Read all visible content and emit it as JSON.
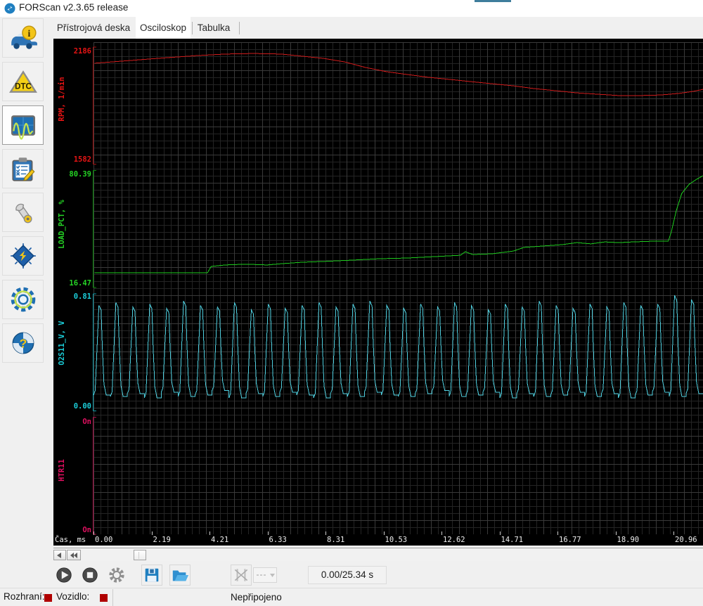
{
  "window": {
    "title": "FORScan v2.3.65 release"
  },
  "colors": {
    "accent": "#1f7fc0",
    "status_indicator": "#b00000",
    "plot_background": "#000000",
    "grid_minor": "#242424",
    "grid_major": "#3a3a3a",
    "background_window_edge": "#3f7d9c"
  },
  "sidebar": {
    "items": [
      {
        "icon": "car-info-icon",
        "selected": false
      },
      {
        "icon": "dtc-warning-triangle-icon",
        "selected": false
      },
      {
        "icon": "oscilloscope-wave-icon",
        "selected": true
      },
      {
        "icon": "clipboard-checklist-icon",
        "selected": false
      },
      {
        "icon": "wrench-icon",
        "selected": false
      },
      {
        "icon": "chip-module-icon",
        "selected": false
      },
      {
        "icon": "gear-icon",
        "selected": false
      },
      {
        "icon": "help-question-icon",
        "selected": false
      }
    ]
  },
  "tabs": [
    {
      "label": "Přístrojová deska",
      "selected": false
    },
    {
      "label": "Osciloskop",
      "selected": true
    },
    {
      "label": "Tabulka",
      "selected": false
    }
  ],
  "chart_data": {
    "type": "line",
    "title": "",
    "xlabel": "Čas, ms",
    "x_ticks": [
      "0.00",
      "2.19",
      "4.21",
      "6.33",
      "8.31",
      "10.53",
      "12.62",
      "14.71",
      "16.77",
      "18.90",
      "20.96"
    ],
    "grid": true,
    "panels": 4,
    "legend": "axis-labels-left",
    "series": [
      {
        "name": "RPM",
        "label": "RPM, 1/min",
        "unit": "1/min",
        "color": "#cf1b1b",
        "label_color": "#e51414",
        "axis_color": "#a81111",
        "axis_max": "2186",
        "axis_min": "1582",
        "ymax": 2186,
        "ymin": 1582,
        "points": [
          [
            0.002,
            2103
          ],
          [
            0.031,
            2110
          ],
          [
            0.077,
            2121
          ],
          [
            0.123,
            2132
          ],
          [
            0.17,
            2142
          ],
          [
            0.216,
            2150
          ],
          [
            0.262,
            2153
          ],
          [
            0.308,
            2150
          ],
          [
            0.343,
            2139
          ],
          [
            0.377,
            2128
          ],
          [
            0.412,
            2110
          ],
          [
            0.446,
            2081
          ],
          [
            0.481,
            2059
          ],
          [
            0.516,
            2044
          ],
          [
            0.55,
            2030
          ],
          [
            0.585,
            2019
          ],
          [
            0.619,
            2008
          ],
          [
            0.654,
            1997
          ],
          [
            0.689,
            1986
          ],
          [
            0.723,
            1972
          ],
          [
            0.758,
            1961
          ],
          [
            0.793,
            1950
          ],
          [
            0.827,
            1943
          ],
          [
            0.862,
            1936
          ],
          [
            0.896,
            1936
          ],
          [
            0.931,
            1939
          ],
          [
            0.96,
            1947
          ],
          [
            0.983,
            1957
          ],
          [
            1.0,
            1968
          ]
        ]
      },
      {
        "name": "LOAD_PCT",
        "label": "LOAD_PCT, %",
        "unit": "%",
        "color": "#1ecb1e",
        "label_color": "#25d425",
        "axis_color": "#0b8f0b",
        "axis_max": "80.39",
        "axis_min": "16.47",
        "ymax": 80.39,
        "ymin": 16.47,
        "points": [
          [
            0.002,
            24.5
          ],
          [
            0.187,
            24.5
          ],
          [
            0.193,
            28.0
          ],
          [
            0.216,
            28.8
          ],
          [
            0.25,
            29.2
          ],
          [
            0.285,
            28.8
          ],
          [
            0.308,
            29.5
          ],
          [
            0.343,
            30.3
          ],
          [
            0.377,
            30.7
          ],
          [
            0.423,
            31.4
          ],
          [
            0.47,
            32.2
          ],
          [
            0.516,
            32.6
          ],
          [
            0.562,
            33.4
          ],
          [
            0.602,
            34.1
          ],
          [
            0.61,
            36.0
          ],
          [
            0.622,
            34.5
          ],
          [
            0.654,
            34.9
          ],
          [
            0.689,
            36.4
          ],
          [
            0.706,
            38.4
          ],
          [
            0.735,
            39.1
          ],
          [
            0.769,
            39.9
          ],
          [
            0.793,
            41.0
          ],
          [
            0.816,
            40.3
          ],
          [
            0.839,
            41.4
          ],
          [
            0.862,
            41.0
          ],
          [
            0.885,
            41.4
          ],
          [
            0.92,
            41.8
          ],
          [
            0.943,
            41.8
          ],
          [
            0.948,
            46.8
          ],
          [
            0.956,
            58.3
          ],
          [
            0.965,
            67.8
          ],
          [
            0.977,
            72.8
          ],
          [
            0.989,
            75.5
          ],
          [
            1.0,
            77.5
          ]
        ]
      },
      {
        "name": "O2S11_V",
        "label": "O2S11_V, V",
        "unit": "V",
        "color": "#4fd0e0",
        "label_color": "#1bcdd8",
        "axis_color": "#0f9aa8",
        "axis_max": "0.81",
        "axis_min": "0.00",
        "ymax": 0.81,
        "ymin": 0.0,
        "waveform": {
          "cycles": 36,
          "cycle_shape": [
            [
              0.0,
              0.0
            ],
            [
              0.1,
              0.05
            ],
            [
              0.32,
              1.0
            ],
            [
              0.45,
              0.95
            ],
            [
              0.52,
              0.55
            ],
            [
              0.62,
              0.12
            ],
            [
              0.75,
              0.0
            ],
            [
              1.0,
              0.0
            ]
          ],
          "peaks": [
            0.73,
            0.75,
            0.72,
            0.74,
            0.71,
            0.76,
            0.73,
            0.72,
            0.75,
            0.7,
            0.74,
            0.71,
            0.73,
            0.75,
            0.72,
            0.74,
            0.76,
            0.73,
            0.71,
            0.74,
            0.72,
            0.75,
            0.73,
            0.7,
            0.74,
            0.72,
            0.76,
            0.73,
            0.71,
            0.74,
            0.72,
            0.75,
            0.73,
            0.74,
            0.8,
            0.77
          ],
          "troughs": [
            0.11,
            0.1,
            0.12,
            0.09,
            0.13,
            0.1,
            0.11,
            0.14,
            0.09,
            0.12,
            0.1,
            0.13,
            0.11,
            0.09,
            0.12,
            0.1,
            0.13,
            0.11,
            0.1,
            0.12,
            0.14,
            0.1,
            0.11,
            0.13,
            0.09,
            0.12,
            0.1,
            0.11,
            0.13,
            0.1,
            0.12,
            0.09,
            0.11,
            0.13,
            0.1,
            0.12
          ]
        }
      },
      {
        "name": "HTR11",
        "label": "HTR11",
        "unit": "",
        "color": "#e01060",
        "label_color": "#e01060",
        "axis_color": "#ad0f49",
        "axis_max": "On",
        "axis_min": "On",
        "ymax": 1,
        "ymin": 0,
        "constant_value": "On",
        "points": []
      }
    ]
  },
  "scrollbar": {
    "scroll_left_icon": "arrow-left-icon",
    "page_left_icon": "double-arrow-left-icon",
    "thumb": "scroll-thumb"
  },
  "toolbar": {
    "play": {
      "icon": "play-icon"
    },
    "stop": {
      "icon": "stop-icon"
    },
    "settings": {
      "icon": "gear-icon"
    },
    "save": {
      "icon": "floppy-disk-icon"
    },
    "open": {
      "icon": "open-folder-icon"
    },
    "line_style": {
      "icon": "dashed-line-icon",
      "value": "",
      "enabled": false
    },
    "clear_markers": {
      "icon": "crossed-markers-icon",
      "enabled": false
    },
    "time_display": "0.00/25.34 s"
  },
  "status_bar": {
    "interface_label": "Rozhraní:",
    "vehicle_label": "Vozidlo:",
    "connection_status": "Nepřipojeno"
  }
}
